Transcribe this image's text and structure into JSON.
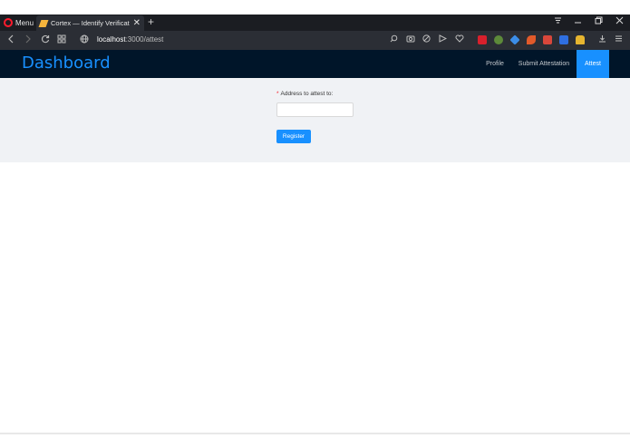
{
  "browser": {
    "menu_label": "Menu",
    "tab_title": "Cortex — Identify Verificati",
    "tab_close": "✕",
    "new_tab": "+",
    "url_host": "localhost",
    "url_path": ":3000/attest"
  },
  "header": {
    "brand": "Dashboard",
    "nav": [
      {
        "label": "Profile"
      },
      {
        "label": "Submit Attestation"
      },
      {
        "label": "Attest"
      }
    ],
    "active_nav": "Attest"
  },
  "form": {
    "field_label": "Address to attest to",
    "required_mark": "*",
    "label_colon": ":",
    "input_value": "",
    "submit_label": "Register"
  },
  "colors": {
    "header_bg": "#001529",
    "brand": "#1890ff",
    "primary": "#1890ff",
    "content_bg": "#f0f2f5"
  }
}
